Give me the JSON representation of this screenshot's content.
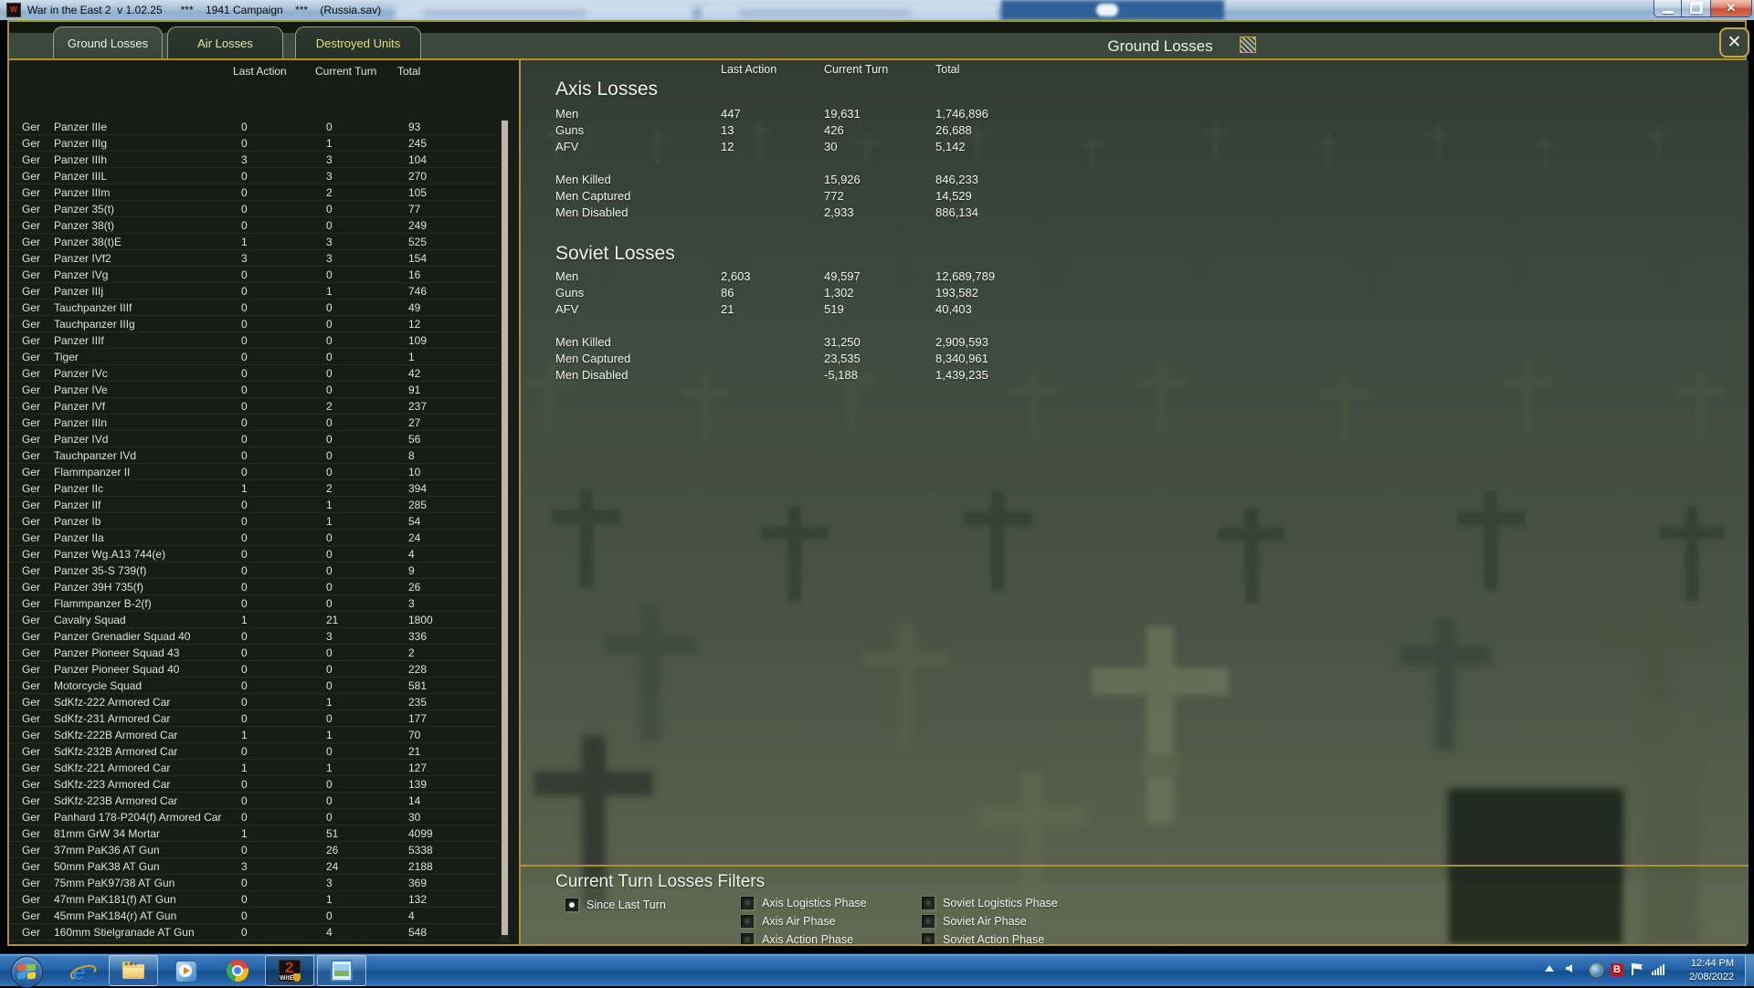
{
  "window": {
    "title": "War in the East 2  v 1.02.25      ***    1941 Campaign    ***    (Russia.sav)",
    "caption_buttons": [
      "minimize",
      "restore",
      "close"
    ]
  },
  "tabs": [
    {
      "label": "Ground Losses",
      "active": true
    },
    {
      "label": "Air Losses",
      "active": false
    },
    {
      "label": "Destroyed Units",
      "active": false
    }
  ],
  "screen": {
    "title": "Ground Losses"
  },
  "columns": {
    "last_action": "Last Action",
    "current_turn": "Current Turn",
    "total": "Total"
  },
  "left_table": {
    "rows": [
      [
        "Ger",
        "Panzer IIIe",
        "0",
        "0",
        "93"
      ],
      [
        "Ger",
        "Panzer IIIg",
        "0",
        "1",
        "245"
      ],
      [
        "Ger",
        "Panzer IIIh",
        "3",
        "3",
        "104"
      ],
      [
        "Ger",
        "Panzer IIIL",
        "0",
        "3",
        "270"
      ],
      [
        "Ger",
        "Panzer IIIm",
        "0",
        "2",
        "105"
      ],
      [
        "Ger",
        "Panzer 35(t)",
        "0",
        "0",
        "77"
      ],
      [
        "Ger",
        "Panzer 38(t)",
        "0",
        "0",
        "249"
      ],
      [
        "Ger",
        "Panzer 38(t)E",
        "1",
        "3",
        "525"
      ],
      [
        "Ger",
        "Panzer IVf2",
        "3",
        "3",
        "154"
      ],
      [
        "Ger",
        "Panzer IVg",
        "0",
        "0",
        "16"
      ],
      [
        "Ger",
        "Panzer IIIj",
        "0",
        "1",
        "746"
      ],
      [
        "Ger",
        "Tauchpanzer IIIf",
        "0",
        "0",
        "49"
      ],
      [
        "Ger",
        "Tauchpanzer IIIg",
        "0",
        "0",
        "12"
      ],
      [
        "Ger",
        "Panzer IIIf",
        "0",
        "0",
        "109"
      ],
      [
        "Ger",
        "Tiger",
        "0",
        "0",
        "1"
      ],
      [
        "Ger",
        "Panzer IVc",
        "0",
        "0",
        "42"
      ],
      [
        "Ger",
        "Panzer IVe",
        "0",
        "0",
        "91"
      ],
      [
        "Ger",
        "Panzer IVf",
        "0",
        "2",
        "237"
      ],
      [
        "Ger",
        "Panzer IIIn",
        "0",
        "0",
        "27"
      ],
      [
        "Ger",
        "Panzer IVd",
        "0",
        "0",
        "56"
      ],
      [
        "Ger",
        "Tauchpanzer IVd",
        "0",
        "0",
        "8"
      ],
      [
        "Ger",
        "Flammpanzer II",
        "0",
        "0",
        "10"
      ],
      [
        "Ger",
        "Panzer IIc",
        "1",
        "2",
        "394"
      ],
      [
        "Ger",
        "Panzer IIf",
        "0",
        "1",
        "285"
      ],
      [
        "Ger",
        "Panzer Ib",
        "0",
        "1",
        "54"
      ],
      [
        "Ger",
        "Panzer IIa",
        "0",
        "0",
        "24"
      ],
      [
        "Ger",
        "Panzer Wg.A13 744(e)",
        "0",
        "0",
        "4"
      ],
      [
        "Ger",
        "Panzer 35-S 739(f)",
        "0",
        "0",
        "9"
      ],
      [
        "Ger",
        "Panzer 39H 735(f)",
        "0",
        "0",
        "26"
      ],
      [
        "Ger",
        "Flammpanzer B-2(f)",
        "0",
        "0",
        "3"
      ],
      [
        "Ger",
        "Cavalry Squad",
        "1",
        "21",
        "1800"
      ],
      [
        "Ger",
        "Panzer Grenadier Squad 40",
        "0",
        "3",
        "336"
      ],
      [
        "Ger",
        "Panzer Pioneer Squad 43",
        "0",
        "0",
        "2"
      ],
      [
        "Ger",
        "Panzer Pioneer Squad 40",
        "0",
        "0",
        "228"
      ],
      [
        "Ger",
        "Motorcycle Squad",
        "0",
        "0",
        "581"
      ],
      [
        "Ger",
        "SdKfz-222 Armored Car",
        "0",
        "1",
        "235"
      ],
      [
        "Ger",
        "SdKfz-231 Armored Car",
        "0",
        "0",
        "177"
      ],
      [
        "Ger",
        "SdKfz-222B Armored Car",
        "1",
        "1",
        "70"
      ],
      [
        "Ger",
        "SdKfz-232B Armored Car",
        "0",
        "0",
        "21"
      ],
      [
        "Ger",
        "SdKfz-221 Armored Car",
        "1",
        "1",
        "127"
      ],
      [
        "Ger",
        "SdKfz-223 Armored Car",
        "0",
        "0",
        "139"
      ],
      [
        "Ger",
        "SdKfz-223B Armored Car",
        "0",
        "0",
        "14"
      ],
      [
        "Ger",
        "Panhard 178-P204(f) Armored Car",
        "0",
        "0",
        "30"
      ],
      [
        "Ger",
        "81mm GrW 34 Mortar",
        "1",
        "51",
        "4099"
      ],
      [
        "Ger",
        "37mm PaK36 AT Gun",
        "0",
        "26",
        "5338"
      ],
      [
        "Ger",
        "50mm PaK38 AT Gun",
        "3",
        "24",
        "2188"
      ],
      [
        "Ger",
        "75mm PaK97/38 AT Gun",
        "0",
        "3",
        "369"
      ],
      [
        "Ger",
        "47mm PaK181(f) AT Gun",
        "0",
        "1",
        "132"
      ],
      [
        "Ger",
        "45mm PaK184(r) AT Gun",
        "0",
        "0",
        "4"
      ],
      [
        "Ger",
        "160mm Stielgranade AT Gun",
        "0",
        "4",
        "548"
      ]
    ]
  },
  "axis_losses": {
    "title": "Axis Losses",
    "rows": [
      [
        "Men",
        "447",
        "19,631",
        "1,746,896"
      ],
      [
        "Guns",
        "13",
        "426",
        "26,688"
      ],
      [
        "AFV",
        "12",
        "30",
        "5,142"
      ]
    ],
    "breakdown": [
      [
        "Men Killed",
        "15,926",
        "846,233"
      ],
      [
        "Men Captured",
        "772",
        "14,529"
      ],
      [
        "Men Disabled",
        "2,933",
        "886,134"
      ]
    ]
  },
  "soviet_losses": {
    "title": "Soviet Losses",
    "rows": [
      [
        "Men",
        "2,603",
        "49,597",
        "12,689,789"
      ],
      [
        "Guns",
        "86",
        "1,302",
        "193,582"
      ],
      [
        "AFV",
        "21",
        "519",
        "40,403"
      ]
    ],
    "breakdown": [
      [
        "Men Killed",
        "31,250",
        "2,909,593"
      ],
      [
        "Men Captured",
        "23,535",
        "8,340,961"
      ],
      [
        "Men Disabled",
        "-5,188",
        "1,439,235"
      ]
    ]
  },
  "filters": {
    "title": "Current Turn Losses Filters",
    "since_last_turn": {
      "label": "Since Last Turn",
      "selected": true
    },
    "axis_phases": [
      "Axis Logistics Phase",
      "Axis Air Phase",
      "Axis Action Phase"
    ],
    "soviet_phases": [
      "Soviet Logistics Phase",
      "Soviet Air Phase",
      "Soviet Action Phase"
    ],
    "phases_checked": false
  },
  "taskbar": {
    "buttons": [
      {
        "icon": "start-orb",
        "active": false
      },
      {
        "icon": "internet-explorer-icon",
        "active": false
      },
      {
        "icon": "windows-explorer-icon",
        "active": true
      },
      {
        "icon": "media-player-icon",
        "active": false
      },
      {
        "icon": "chrome-icon",
        "active": false
      },
      {
        "icon": "wite2-game-icon",
        "active": true,
        "current": true
      },
      {
        "icon": "photo-viewer-icon",
        "active": true
      }
    ],
    "tray_icons": [
      "show-hidden-icons",
      "volume",
      "windows-update",
      "bitdefender",
      "action-center-flag",
      "network-signal"
    ],
    "clock": {
      "time": "12:44 PM",
      "date": "2/08/2022"
    }
  },
  "colors": {
    "gold_border": "#ab8f35",
    "panel_green": "#3c473d",
    "table_bg": "#171c17",
    "tab_text_active": "#e9ede6",
    "tab_text_air": "#dbe6a4",
    "tab_text_destroyed": "#e6df76",
    "taskbar_blue": "#2264a8",
    "close_button_red": "#c4523a"
  }
}
